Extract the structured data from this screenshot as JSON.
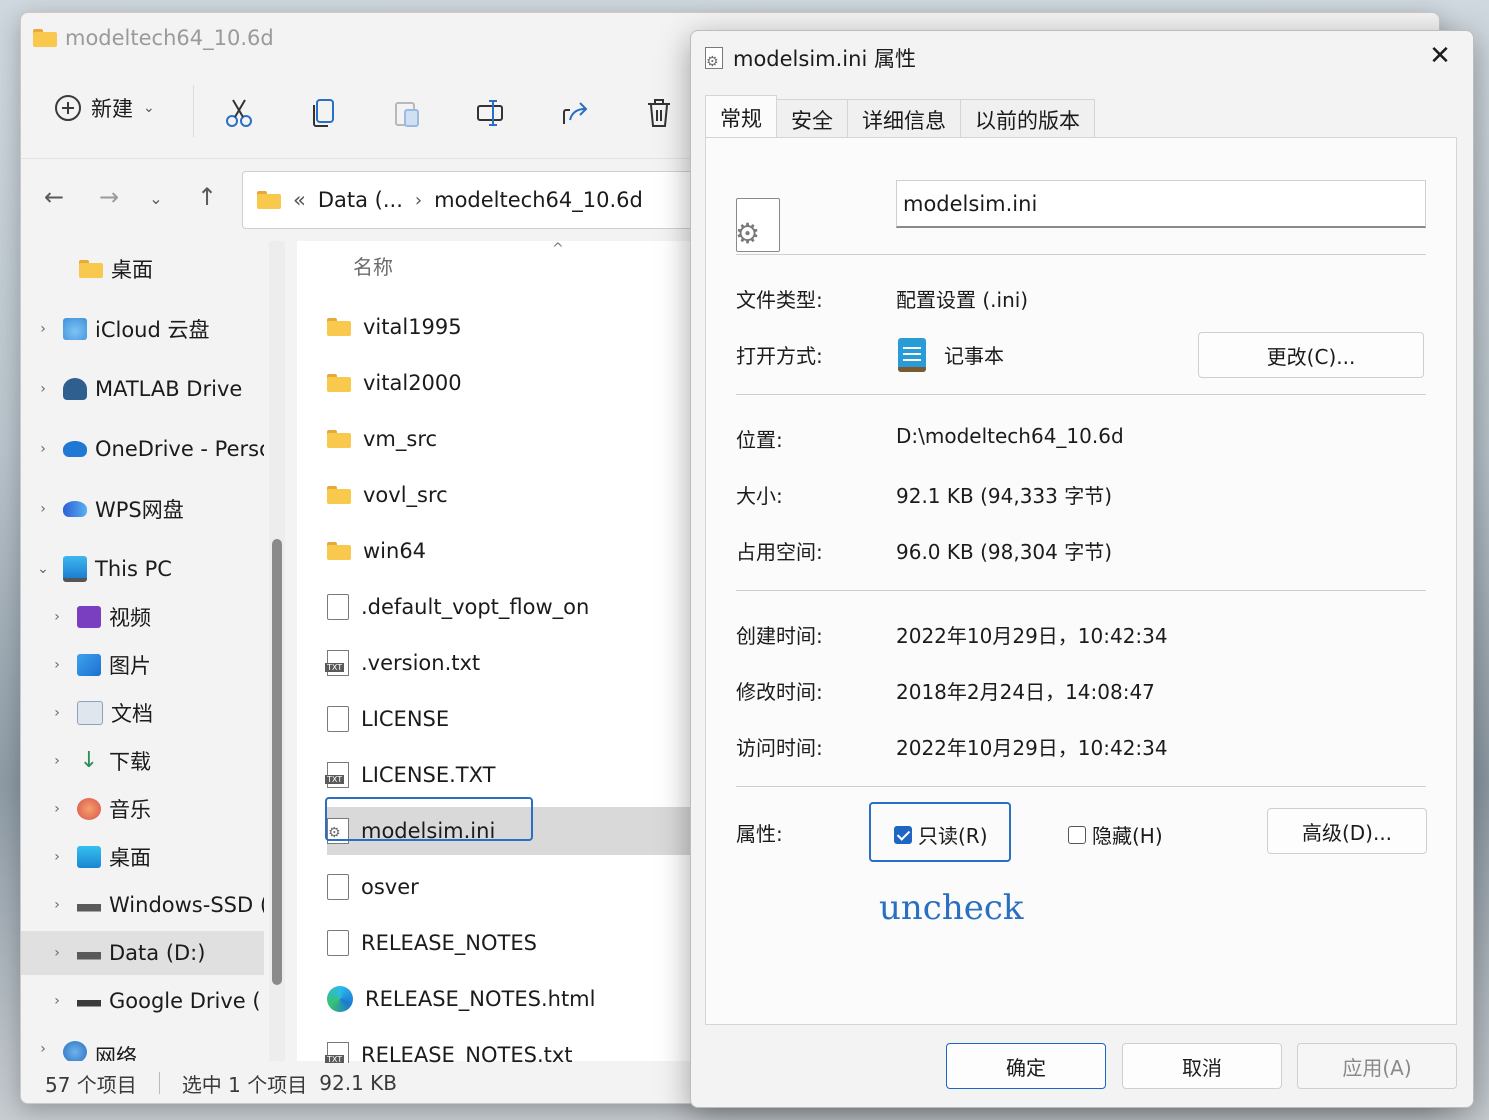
{
  "explorer": {
    "title": "modeltech64_10.6d",
    "toolbar": {
      "new_label": "新建",
      "icons": [
        "cut-icon",
        "copy-icon",
        "paste-icon",
        "rename-icon",
        "share-icon",
        "delete-icon"
      ]
    },
    "address": {
      "overflow": "«",
      "crumbs": [
        "Data (...",
        "modeltech64_10.6d"
      ],
      "separator": "›"
    },
    "sidebar": [
      {
        "label": "桌面",
        "expand": false,
        "level": 1,
        "icon": "folder-icon"
      },
      {
        "label": "iCloud 云盘",
        "expand": true,
        "level": 0,
        "icon": "icloud-icon"
      },
      {
        "label": "MATLAB Drive",
        "expand": true,
        "level": 0,
        "icon": "matlab-drive-icon"
      },
      {
        "label": "OneDrive - Perso",
        "expand": true,
        "level": 0,
        "icon": "onedrive-icon"
      },
      {
        "label": "WPS网盘",
        "expand": true,
        "level": 0,
        "icon": "wps-cloud-icon"
      },
      {
        "label": "This PC",
        "expand": true,
        "level": 0,
        "icon": "this-pc-icon"
      },
      {
        "label": "视频",
        "expand": true,
        "level": 1,
        "icon": "videos-icon"
      },
      {
        "label": "图片",
        "expand": true,
        "level": 1,
        "icon": "pictures-icon"
      },
      {
        "label": "文档",
        "expand": true,
        "level": 1,
        "icon": "documents-icon"
      },
      {
        "label": "下载",
        "expand": true,
        "level": 1,
        "icon": "downloads-icon"
      },
      {
        "label": "音乐",
        "expand": true,
        "level": 1,
        "icon": "music-icon"
      },
      {
        "label": "桌面",
        "expand": true,
        "level": 1,
        "icon": "desktop-icon"
      },
      {
        "label": "Windows-SSD (",
        "expand": true,
        "level": 1,
        "icon": "drive-icon"
      },
      {
        "label": "Data (D:)",
        "expand": true,
        "level": 1,
        "icon": "drive-icon"
      },
      {
        "label": "Google Drive (",
        "expand": true,
        "level": 1,
        "icon": "drive-icon"
      },
      {
        "label": "网络",
        "expand": true,
        "level": 0,
        "icon": "network-icon"
      }
    ],
    "list_header": "名称",
    "files": [
      {
        "name": "vital1995",
        "type": "folder"
      },
      {
        "name": "vital2000",
        "type": "folder"
      },
      {
        "name": "vm_src",
        "type": "folder"
      },
      {
        "name": "vovl_src",
        "type": "folder"
      },
      {
        "name": "win64",
        "type": "folder"
      },
      {
        "name": ".default_vopt_flow_on",
        "type": "file"
      },
      {
        "name": ".version.txt",
        "type": "txt"
      },
      {
        "name": "LICENSE",
        "type": "file"
      },
      {
        "name": "LICENSE.TXT",
        "type": "txt"
      },
      {
        "name": "modelsim.ini",
        "type": "ini"
      },
      {
        "name": "osver",
        "type": "file"
      },
      {
        "name": "RELEASE_NOTES",
        "type": "file"
      },
      {
        "name": "RELEASE_NOTES.html",
        "type": "edge"
      },
      {
        "name": "RELEASE_NOTES.txt",
        "type": "txt"
      }
    ],
    "status": {
      "count": "57 个项目",
      "selected": "选中 1 个项目",
      "size": "92.1 KB"
    }
  },
  "dialog": {
    "title": "modelsim.ini 属性",
    "tabs": [
      "常规",
      "安全",
      "详细信息",
      "以前的版本"
    ],
    "filename": "modelsim.ini",
    "file_type_label": "文件类型:",
    "file_type": "配置设置 (.ini)",
    "open_with_label": "打开方式:",
    "open_with": "记事本",
    "change_button": "更改(C)...",
    "location_label": "位置:",
    "location": "D:\\modeltech64_10.6d",
    "size_label": "大小:",
    "size": "92.1 KB (94,333 字节)",
    "disk_size_label": "占用空间:",
    "disk_size": "96.0 KB (98,304 字节)",
    "created_label": "创建时间:",
    "created": "2022年10月29日，10:42:34",
    "modified_label": "修改时间:",
    "modified": "2018年2月24日，14:08:47",
    "accessed_label": "访问时间:",
    "accessed": "2022年10月29日，10:42:34",
    "attributes_label": "属性:",
    "readonly_label": "只读(R)",
    "readonly_checked": true,
    "hidden_label": "隐藏(H)",
    "hidden_checked": false,
    "advanced_button": "高级(D)...",
    "annotation": "uncheck",
    "ok_button": "确定",
    "cancel_button": "取消",
    "apply_button": "应用(A)"
  }
}
